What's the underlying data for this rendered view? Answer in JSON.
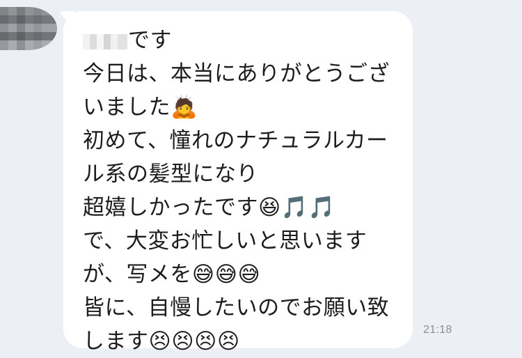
{
  "chat": {
    "message": {
      "lines": [
        "です",
        "今日は、本当にありがとうござ",
        "いました🙇",
        "初めて、憧れのナチュラルカー",
        "ル系の髪型になり",
        "超嬉しかったです😆🎵🎵",
        "で、大変お忙しいと思います",
        "が、写メを😅😅😅",
        "皆に、自慢したいのでお願い致",
        "します😣😣😣😣"
      ]
    },
    "time": "21:18"
  }
}
